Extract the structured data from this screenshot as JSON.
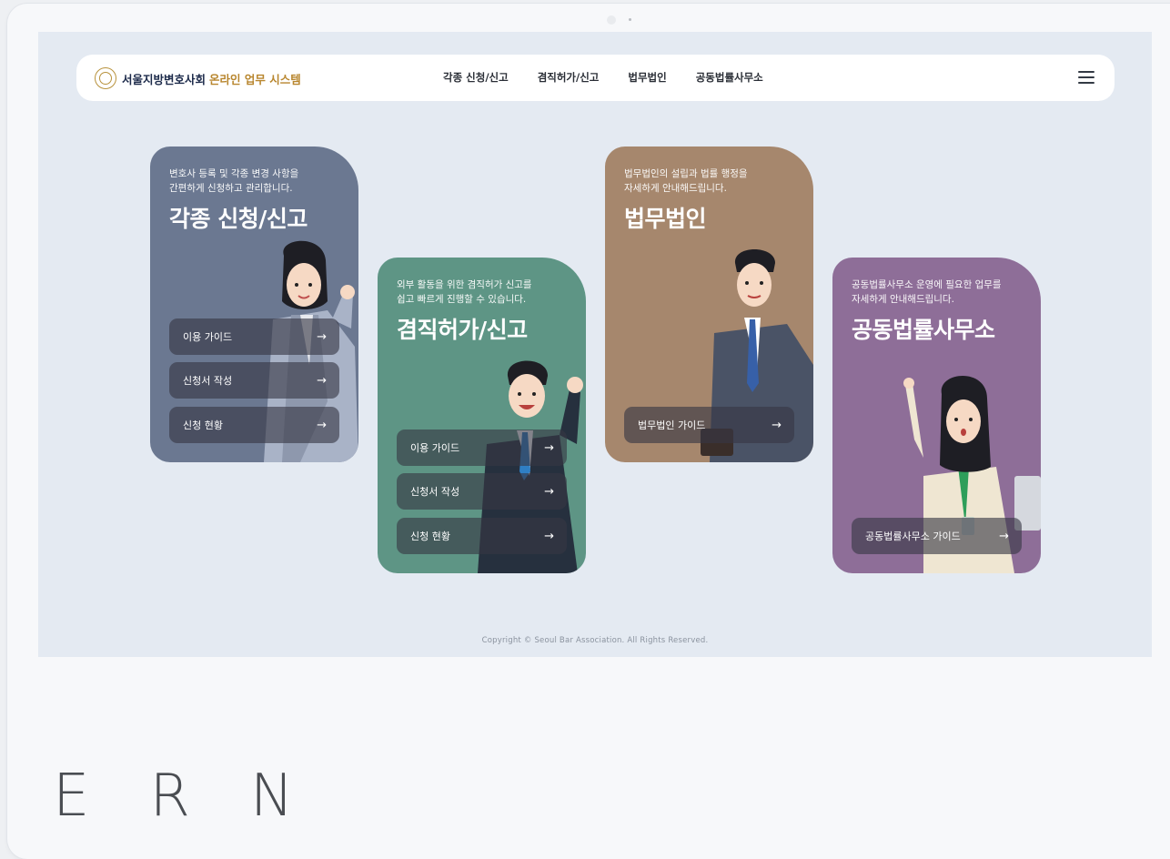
{
  "header": {
    "logo_main": "서울지방변호사회",
    "logo_sub": "온라인 업무 시스템",
    "nav": [
      "각종 신청/신고",
      "겸직허가/신고",
      "법무법인",
      "공동법률사무소"
    ]
  },
  "cards": [
    {
      "desc": "변호사 등록 및 각종 변경 사항을\n간편하게 신청하고 관리합니다.",
      "title": "각종 신청/신고",
      "color": "#6b7891",
      "buttons": [
        "이용 가이드",
        "신청서 작성",
        "신청 현황"
      ]
    },
    {
      "desc": "외부 활동을 위한 겸직허가 신고를\n쉽고 빠르게 진행할 수 있습니다.",
      "title": "겸직허가/신고",
      "color": "#5e9585",
      "buttons": [
        "이용 가이드",
        "신청서 작성",
        "신청 현황"
      ]
    },
    {
      "desc": "법무법인의 설립과 법률 행정을\n자세하게 안내해드립니다.",
      "title": "법무법인",
      "color": "#a6876d",
      "buttons": [
        "법무법인 가이드"
      ]
    },
    {
      "desc": "공동법률사무소 운영에 필요한 업무를\n자세하게 안내해드립니다.",
      "title": "공동법률사무소",
      "color": "#8e6e98",
      "buttons": [
        "공동법률사무소 가이드"
      ]
    }
  ],
  "arrow": "→",
  "footer": {
    "copyright": "Copyright © Seoul Bar Association. All Rights Reserved."
  },
  "bottom_text": "ERN"
}
